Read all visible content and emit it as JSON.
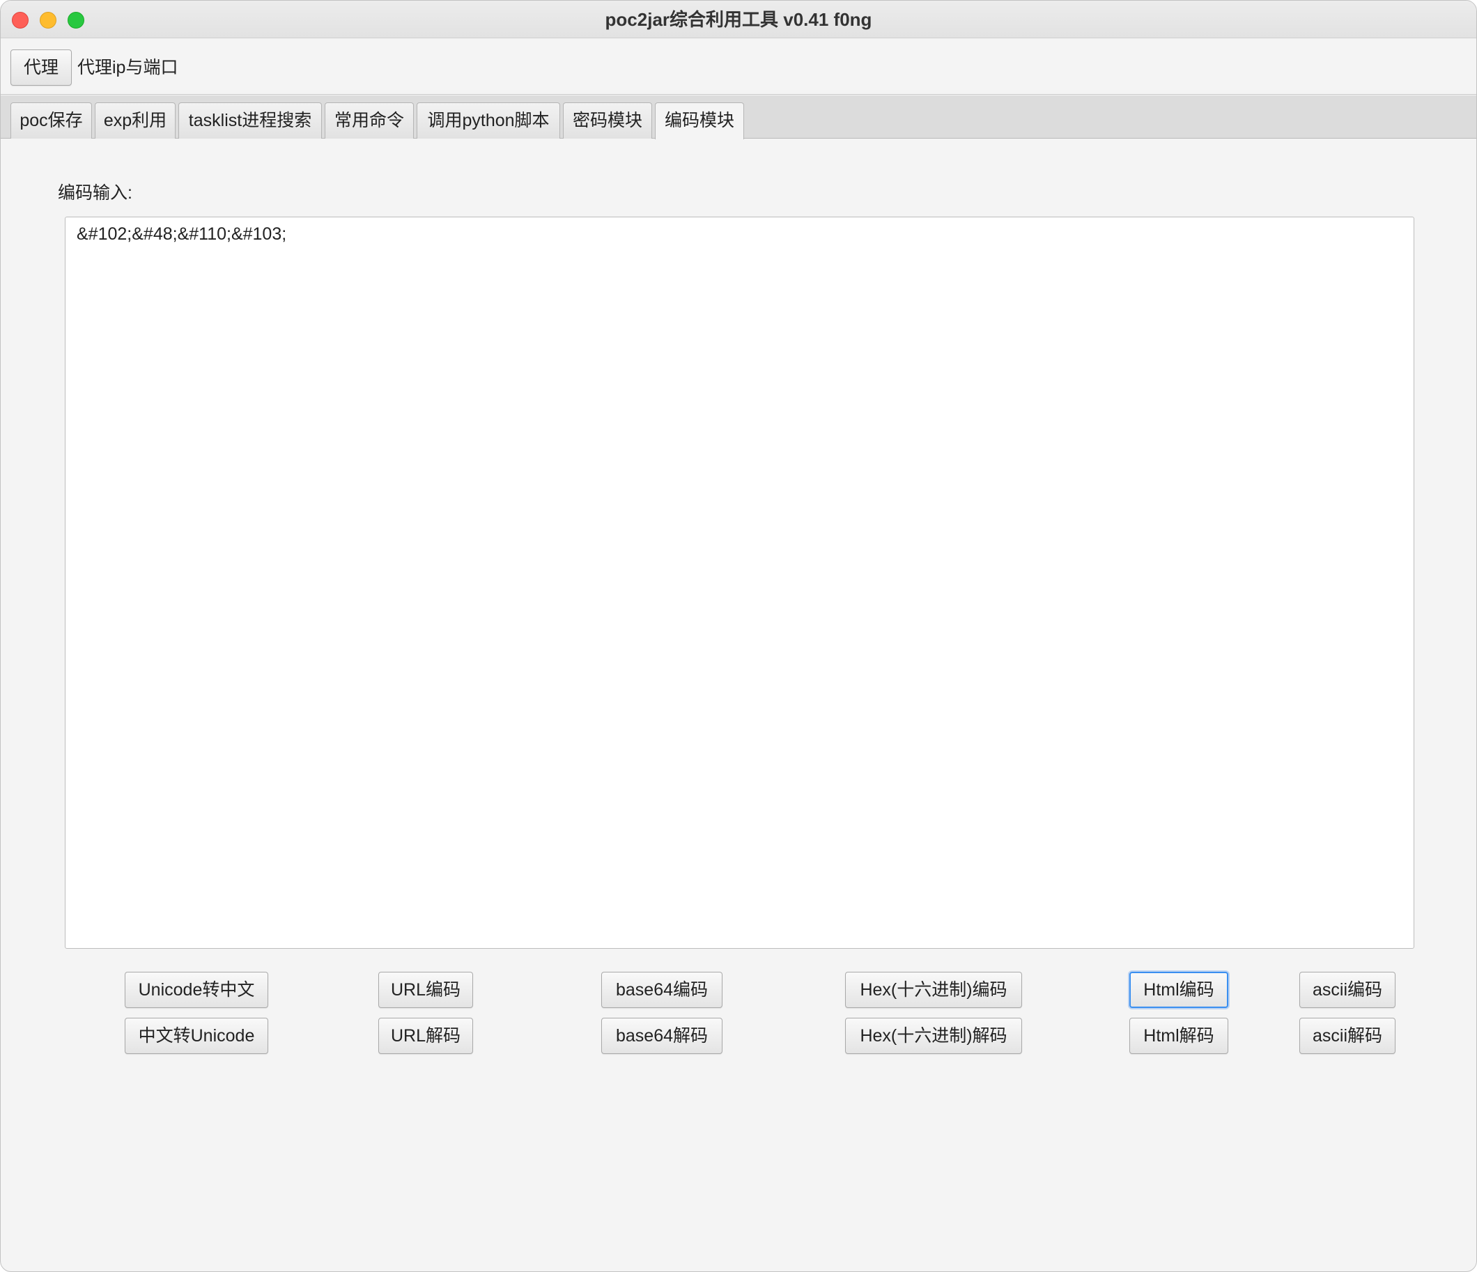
{
  "window": {
    "title": "poc2jar综合利用工具 v0.41  f0ng"
  },
  "proxy": {
    "button_label": "代理",
    "label": "代理ip与端口"
  },
  "tabs": [
    {
      "label": "poc保存",
      "active": false
    },
    {
      "label": "exp利用",
      "active": false
    },
    {
      "label": "tasklist进程搜索",
      "active": false
    },
    {
      "label": "常用命令",
      "active": false
    },
    {
      "label": "调用python脚本",
      "active": false
    },
    {
      "label": "密码模块",
      "active": false
    },
    {
      "label": "编码模块",
      "active": true
    }
  ],
  "encoder": {
    "input_label": "编码输入:",
    "input_value": "&#102;&#48;&#110;&#103;",
    "buttons_row1": [
      "Unicode转中文",
      "URL编码",
      "base64编码",
      "Hex(十六进制)编码",
      "Html编码",
      "ascii编码"
    ],
    "buttons_row2": [
      "中文转Unicode",
      "URL解码",
      "base64解码",
      "Hex(十六进制)解码",
      "Html解码",
      "ascii解码"
    ],
    "focused_button": "Html编码"
  },
  "colors": {
    "focus_ring": "#3a8ff0",
    "window_bg": "#f4f4f4"
  }
}
